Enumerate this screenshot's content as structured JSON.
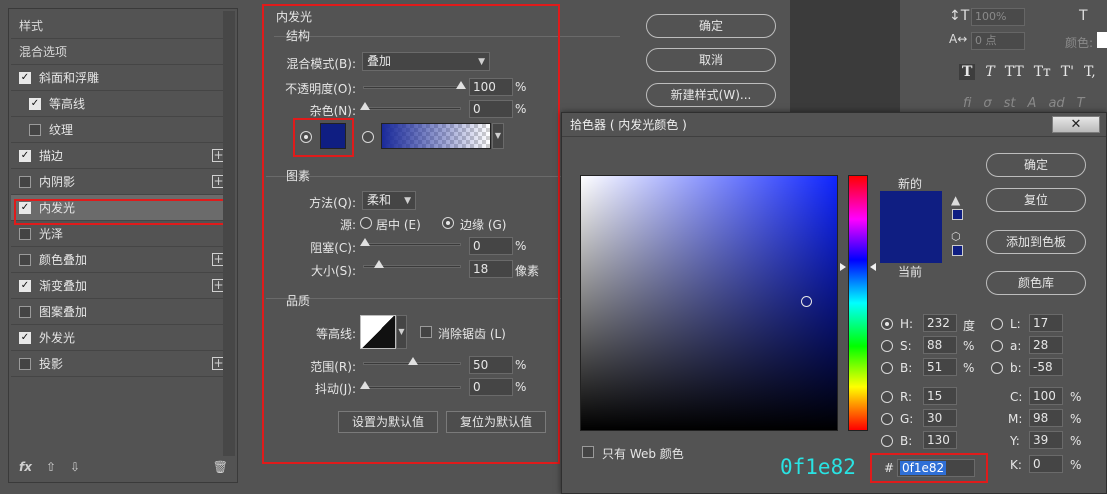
{
  "style_list": {
    "items": [
      {
        "label": "样式",
        "checkbox": null,
        "indent": false,
        "plus": false,
        "selected": false
      },
      {
        "label": "混合选项",
        "checkbox": null,
        "indent": false,
        "plus": false,
        "selected": false
      },
      {
        "label": "斜面和浮雕",
        "checkbox": true,
        "indent": false,
        "plus": false,
        "selected": false
      },
      {
        "label": "等高线",
        "checkbox": true,
        "indent": true,
        "plus": false,
        "selected": false
      },
      {
        "label": "纹理",
        "checkbox": false,
        "indent": true,
        "plus": false,
        "selected": false
      },
      {
        "label": "描边",
        "checkbox": true,
        "indent": false,
        "plus": true,
        "selected": false
      },
      {
        "label": "内阴影",
        "checkbox": false,
        "indent": false,
        "plus": true,
        "selected": false
      },
      {
        "label": "内发光",
        "checkbox": true,
        "indent": false,
        "plus": false,
        "selected": true
      },
      {
        "label": "光泽",
        "checkbox": false,
        "indent": false,
        "plus": false,
        "selected": false
      },
      {
        "label": "颜色叠加",
        "checkbox": false,
        "indent": false,
        "plus": true,
        "selected": false
      },
      {
        "label": "渐变叠加",
        "checkbox": true,
        "indent": false,
        "plus": true,
        "selected": false
      },
      {
        "label": "图案叠加",
        "checkbox": false,
        "indent": false,
        "plus": false,
        "selected": false
      },
      {
        "label": "外发光",
        "checkbox": true,
        "indent": false,
        "plus": false,
        "selected": false
      },
      {
        "label": "投影",
        "checkbox": false,
        "indent": false,
        "plus": true,
        "selected": false
      }
    ],
    "footer_fx": "fx"
  },
  "inner_glow": {
    "title": "内发光",
    "structure": {
      "heading": "结构",
      "blend_mode_label": "混合模式(B):",
      "blend_mode_value": "叠加",
      "opacity_label": "不透明度(O):",
      "opacity_value": "100",
      "noise_label": "杂色(N):",
      "noise_value": "0",
      "percent": "%"
    },
    "elements": {
      "heading": "图素",
      "technique_label": "方法(Q):",
      "technique_value": "柔和",
      "source_label": "源:",
      "source_center": "居中 (E)",
      "source_edge": "边缘 (G)",
      "choke_label": "阻塞(C):",
      "choke_value": "0",
      "size_label": "大小(S):",
      "size_value": "18",
      "size_unit": "像素"
    },
    "quality": {
      "heading": "品质",
      "contour_label": "等高线:",
      "anti_alias_label": "消除锯齿 (L)",
      "range_label": "范围(R):",
      "range_value": "50",
      "jitter_label": "抖动(J):",
      "jitter_value": "0"
    },
    "make_default": "设置为默认值",
    "reset_default": "复位为默认值"
  },
  "dialog_buttons": {
    "ok": "确定",
    "cancel": "取消",
    "new_style": "新建样式(W)..."
  },
  "color_picker": {
    "title": "拾色器 ( 内发光颜色 )",
    "new_label": "新的",
    "current_label": "当前",
    "ok": "确定",
    "reset": "复位",
    "add_to_swatches": "添加到色板",
    "color_libraries": "颜色库",
    "web_only": "只有 Web 颜色",
    "H": "232",
    "H_unit": "度",
    "S": "88",
    "S_unit": "%",
    "Bv": "51",
    "B_unit": "%",
    "R": "15",
    "G": "30",
    "Bc": "130",
    "L": "17",
    "a": "28",
    "b": "-58",
    "C": "100",
    "M": "98",
    "Y": "39",
    "K": "0",
    "percent": "%",
    "hex_label": "#",
    "hex_value": "0f1e82",
    "hex_annotation": "0f1e82",
    "swatch_color": "#0f1e82"
  },
  "tools_panel": {
    "leading": "100%",
    "tracking": "0 点",
    "color_label": "颜色:",
    "typo_buttons": [
      "T",
      "T",
      "TT",
      "Tт",
      "T'",
      "T,"
    ]
  },
  "colors": {
    "accent_red": "#e01b1b",
    "panel_bg": "#535353",
    "glow_color": "#0f1e82",
    "hex_annotation_color": "#29e3e3"
  }
}
